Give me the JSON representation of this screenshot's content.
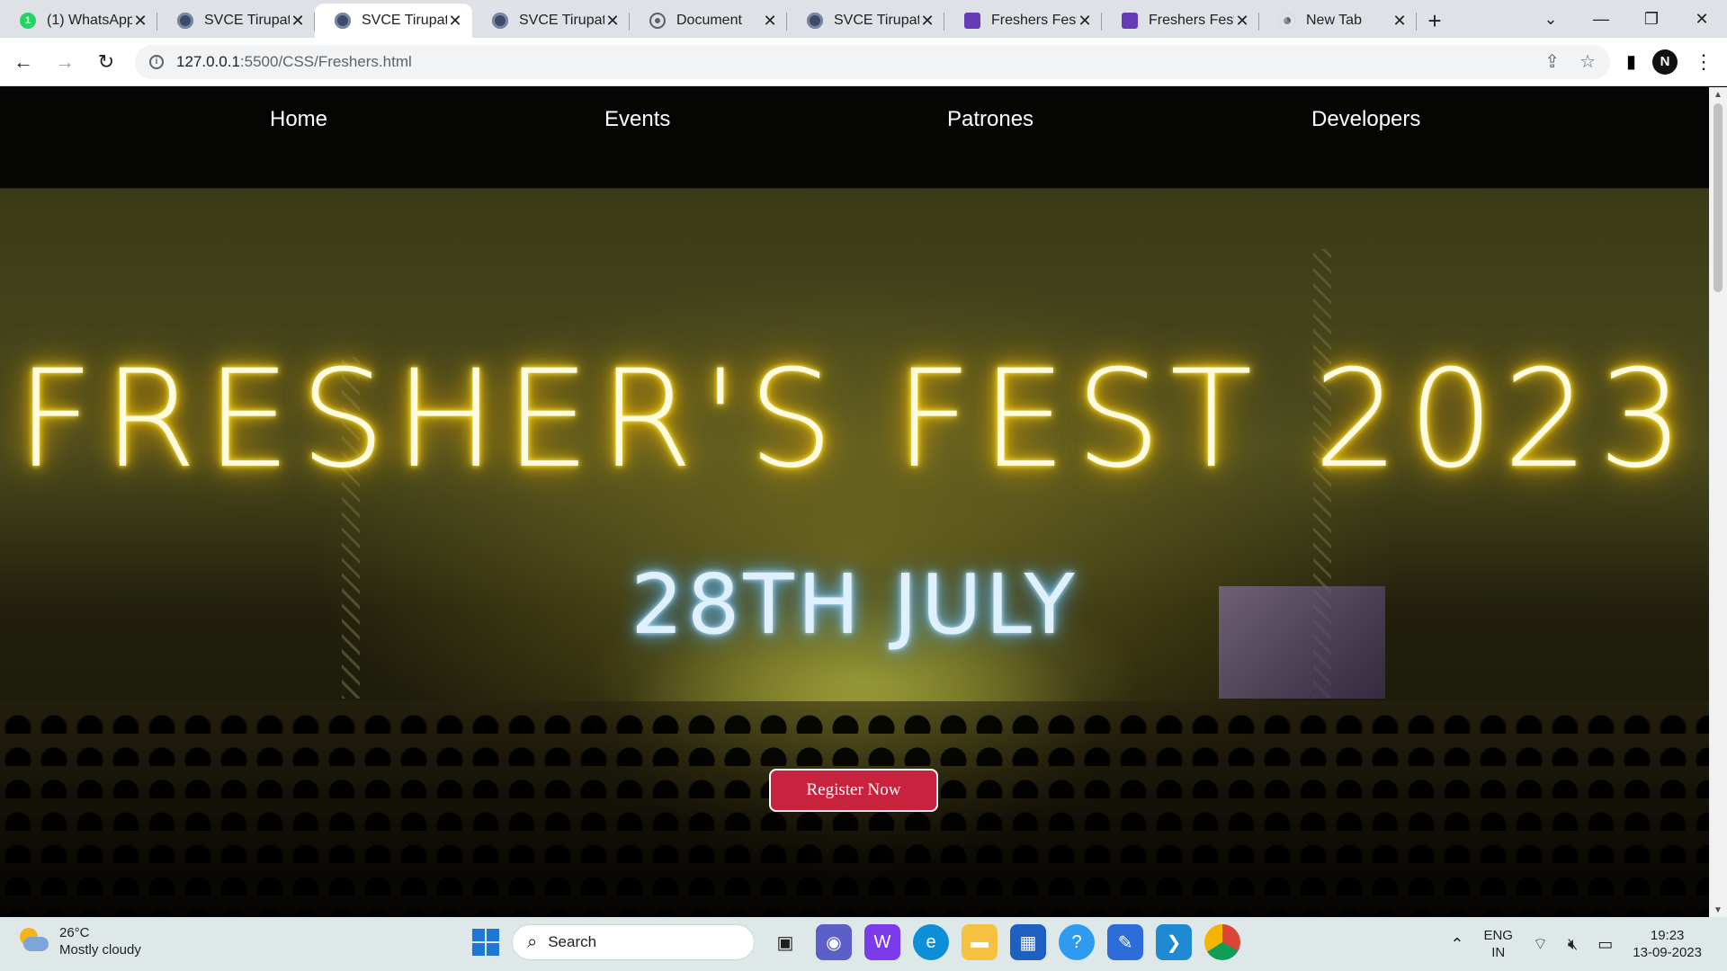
{
  "browser": {
    "tabs": [
      {
        "title": "(1) WhatsApp",
        "icon": "whatsapp-icon",
        "badge": "1",
        "active": false
      },
      {
        "title": "SVCE Tirupati",
        "icon": "svce-icon",
        "active": false
      },
      {
        "title": "SVCE Tirupati",
        "icon": "svce-icon",
        "active": true
      },
      {
        "title": "SVCE Tirupati",
        "icon": "svce-icon",
        "active": false
      },
      {
        "title": "Document",
        "icon": "globe-icon",
        "active": false
      },
      {
        "title": "SVCE Tirupati",
        "icon": "svce-icon",
        "active": false
      },
      {
        "title": "Freshers Fest R",
        "icon": "forms-icon",
        "active": false
      },
      {
        "title": "Freshers Fest R",
        "icon": "forms-icon",
        "active": false
      },
      {
        "title": "New Tab",
        "icon": "chrome-icon",
        "active": false
      }
    ],
    "url_host": "127.0.0.1",
    "url_path": ":5500/CSS/Freshers.html",
    "profile_initial": "N"
  },
  "page": {
    "nav": [
      "Home",
      "Events",
      "Patrones",
      "Developers"
    ],
    "headline": "FRESHER'S FEST 2023",
    "date": "28TH JULY",
    "register_label": "Register Now",
    "colors": {
      "headline_glow": "#ffd400",
      "date_glow": "#6fc3ff",
      "register_bg": "#c8233e"
    }
  },
  "taskbar": {
    "weather_temp": "26°C",
    "weather_desc": "Mostly cloudy",
    "search_label": "Search",
    "lang_line1": "ENG",
    "lang_line2": "IN",
    "time": "19:23",
    "date": "13-09-2023"
  }
}
